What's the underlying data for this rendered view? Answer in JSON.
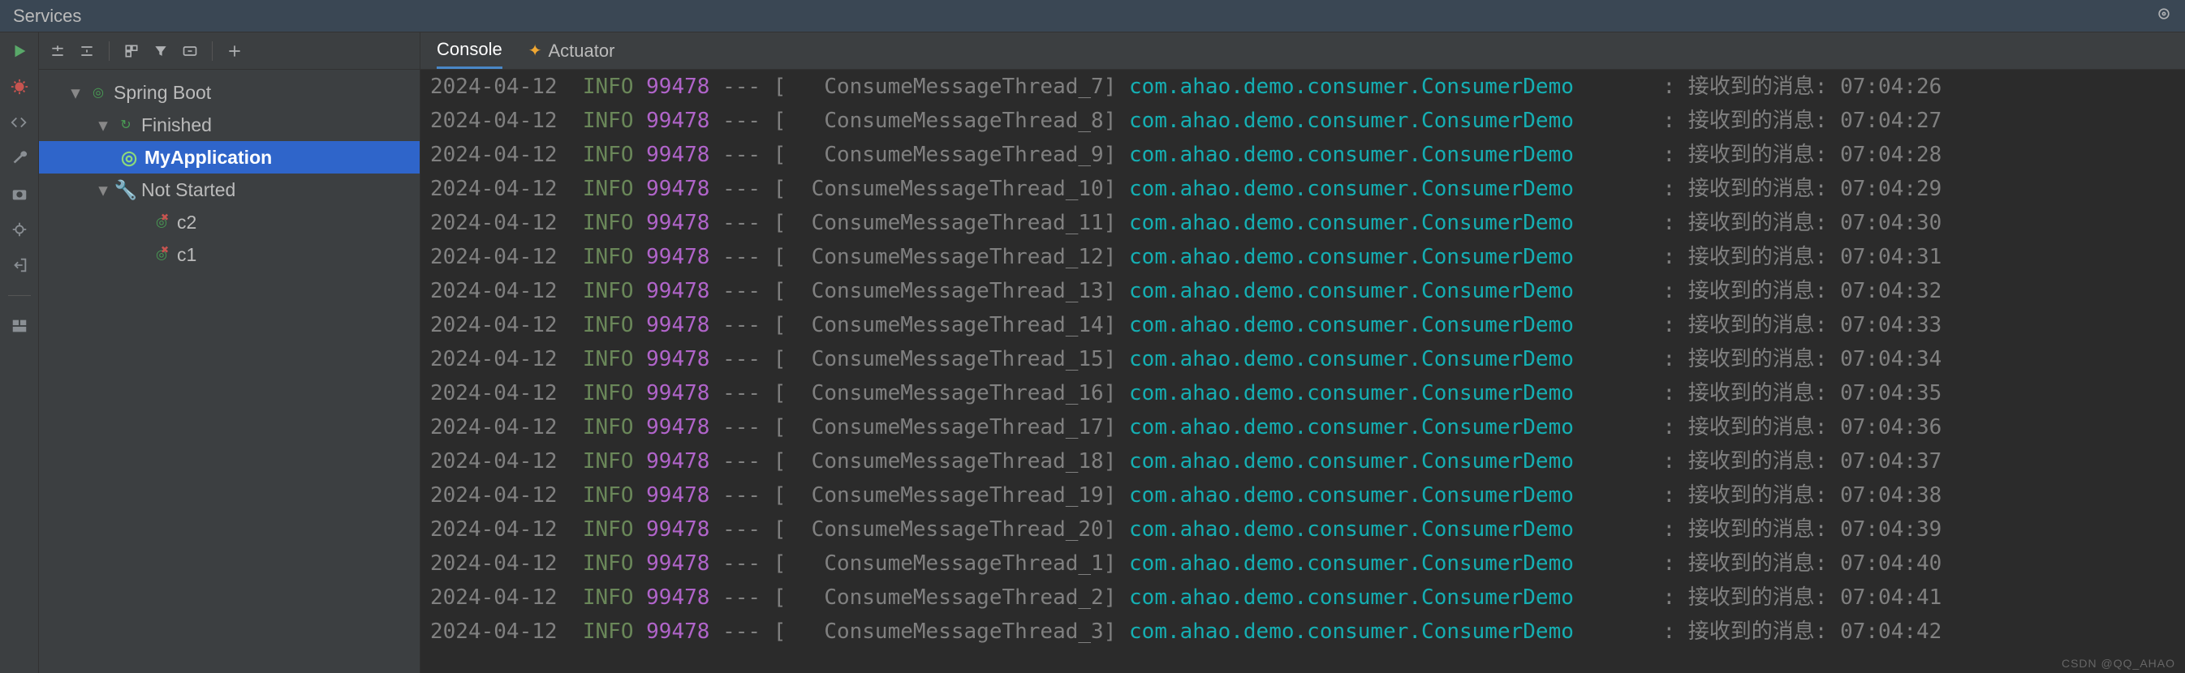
{
  "header": {
    "title": "Services"
  },
  "toolbar": {},
  "tabs": {
    "console": "Console",
    "actuator": "Actuator"
  },
  "tree": {
    "root": "Spring Boot",
    "finished": "Finished",
    "notStarted": "Not Started",
    "app": "MyApplication",
    "c2": "c2",
    "c1": "c1"
  },
  "console": {
    "logger": "com.ahao.demo.consumer.ConsumerDemo",
    "msgLabel": "接收到的消息:",
    "rows": [
      {
        "date": "2024-04-12",
        "level": "INFO",
        "pid": "99478",
        "thread": "ConsumeMessageThread_7",
        "time": "07:04:26"
      },
      {
        "date": "2024-04-12",
        "level": "INFO",
        "pid": "99478",
        "thread": "ConsumeMessageThread_8",
        "time": "07:04:27"
      },
      {
        "date": "2024-04-12",
        "level": "INFO",
        "pid": "99478",
        "thread": "ConsumeMessageThread_9",
        "time": "07:04:28"
      },
      {
        "date": "2024-04-12",
        "level": "INFO",
        "pid": "99478",
        "thread": "ConsumeMessageThread_10",
        "time": "07:04:29"
      },
      {
        "date": "2024-04-12",
        "level": "INFO",
        "pid": "99478",
        "thread": "ConsumeMessageThread_11",
        "time": "07:04:30"
      },
      {
        "date": "2024-04-12",
        "level": "INFO",
        "pid": "99478",
        "thread": "ConsumeMessageThread_12",
        "time": "07:04:31"
      },
      {
        "date": "2024-04-12",
        "level": "INFO",
        "pid": "99478",
        "thread": "ConsumeMessageThread_13",
        "time": "07:04:32"
      },
      {
        "date": "2024-04-12",
        "level": "INFO",
        "pid": "99478",
        "thread": "ConsumeMessageThread_14",
        "time": "07:04:33"
      },
      {
        "date": "2024-04-12",
        "level": "INFO",
        "pid": "99478",
        "thread": "ConsumeMessageThread_15",
        "time": "07:04:34"
      },
      {
        "date": "2024-04-12",
        "level": "INFO",
        "pid": "99478",
        "thread": "ConsumeMessageThread_16",
        "time": "07:04:35"
      },
      {
        "date": "2024-04-12",
        "level": "INFO",
        "pid": "99478",
        "thread": "ConsumeMessageThread_17",
        "time": "07:04:36"
      },
      {
        "date": "2024-04-12",
        "level": "INFO",
        "pid": "99478",
        "thread": "ConsumeMessageThread_18",
        "time": "07:04:37"
      },
      {
        "date": "2024-04-12",
        "level": "INFO",
        "pid": "99478",
        "thread": "ConsumeMessageThread_19",
        "time": "07:04:38"
      },
      {
        "date": "2024-04-12",
        "level": "INFO",
        "pid": "99478",
        "thread": "ConsumeMessageThread_20",
        "time": "07:04:39"
      },
      {
        "date": "2024-04-12",
        "level": "INFO",
        "pid": "99478",
        "thread": "ConsumeMessageThread_1",
        "time": "07:04:40"
      },
      {
        "date": "2024-04-12",
        "level": "INFO",
        "pid": "99478",
        "thread": "ConsumeMessageThread_2",
        "time": "07:04:41"
      },
      {
        "date": "2024-04-12",
        "level": "INFO",
        "pid": "99478",
        "thread": "ConsumeMessageThread_3",
        "time": "07:04:42"
      }
    ]
  },
  "watermark": "CSDN @QQ_AHAO"
}
